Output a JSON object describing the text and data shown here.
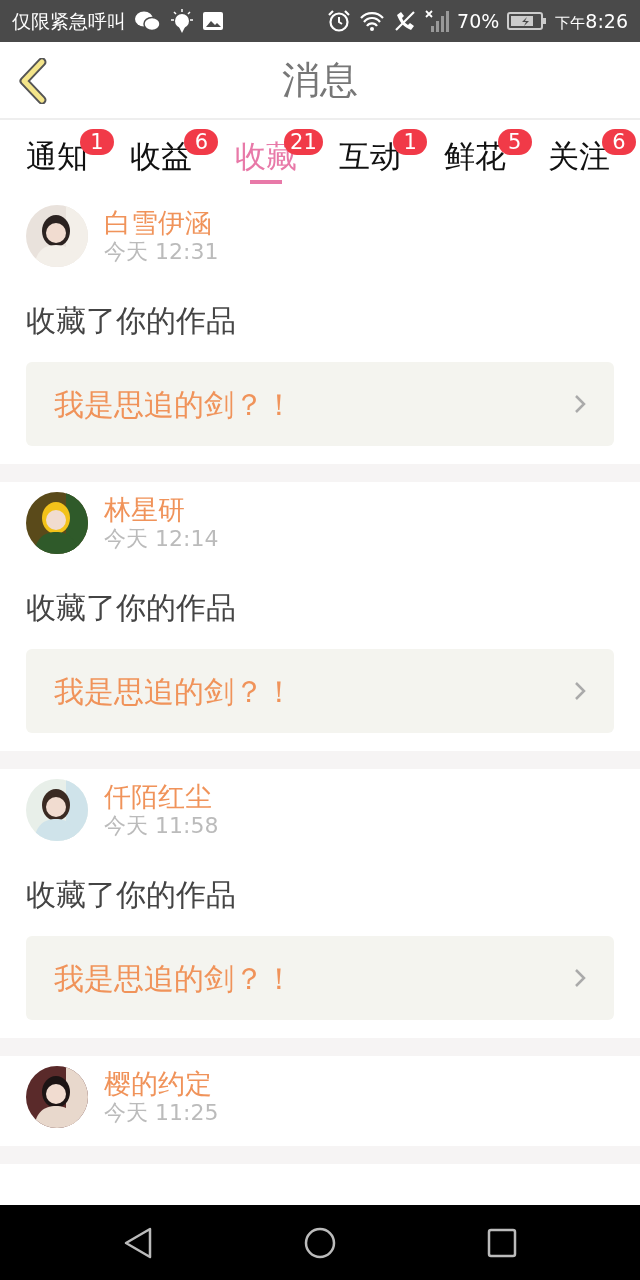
{
  "status_bar": {
    "carrier_text": "仅限紧急呼叫",
    "battery_text": "70%",
    "time_period": "下午",
    "time": "8:26"
  },
  "header": {
    "title": "消息"
  },
  "tabs": [
    {
      "label": "通知",
      "badge": "1",
      "selected": false
    },
    {
      "label": "收益",
      "badge": "6",
      "selected": false
    },
    {
      "label": "收藏",
      "badge": "21",
      "selected": true
    },
    {
      "label": "互动",
      "badge": "1",
      "selected": false
    },
    {
      "label": "鲜花",
      "badge": "5",
      "selected": false
    },
    {
      "label": "关注",
      "badge": "6",
      "selected": false
    }
  ],
  "messages": [
    {
      "name": "白雪伊涵",
      "time": "今天 12:31",
      "action": "收藏了你的作品",
      "work": "我是思追的剑？！"
    },
    {
      "name": "林星研",
      "time": "今天 12:14",
      "action": "收藏了你的作品",
      "work": "我是思追的剑？！"
    },
    {
      "name": "仟陌红尘",
      "time": "今天 11:58",
      "action": "收藏了你的作品",
      "work": "我是思追的剑？！"
    },
    {
      "name": "樱的约定",
      "time": "今天 11:25"
    }
  ]
}
